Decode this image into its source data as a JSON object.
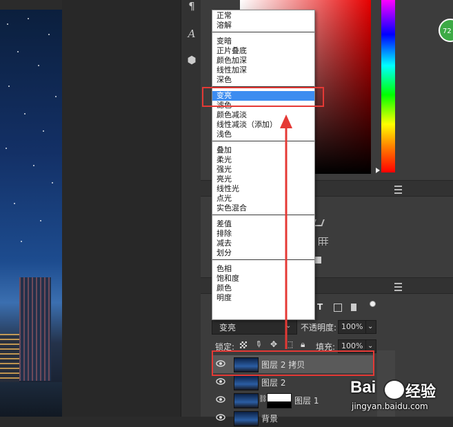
{
  "blend_modes": {
    "groups": [
      [
        "正常",
        "溶解"
      ],
      [
        "变暗",
        "正片叠底",
        "颜色加深",
        "线性加深",
        "深色"
      ],
      [
        "变亮",
        "滤色",
        "颜色减淡",
        "线性减淡（添加）",
        "浅色"
      ],
      [
        "叠加",
        "柔光",
        "强光",
        "亮光",
        "线性光",
        "点光",
        "实色混合"
      ],
      [
        "差值",
        "排除",
        "减去",
        "划分"
      ],
      [
        "色相",
        "饱和度",
        "颜色",
        "明度"
      ]
    ],
    "selected": "变亮"
  },
  "layers_panel": {
    "blend_mode_value": "变亮",
    "opacity_label": "不透明度:",
    "opacity_value": "100%",
    "lock_label": "锁定:",
    "fill_label": "填充:",
    "fill_value": "100%",
    "layers": [
      {
        "name": "图层 2 拷贝",
        "selected": true
      },
      {
        "name": "图层 2",
        "selected": false
      },
      {
        "name": "图层 1",
        "selected": false,
        "has_mask": true
      },
      {
        "name": "背景",
        "selected": false
      }
    ]
  },
  "toolstrip": {
    "icons": [
      "paragraph-icon",
      "character-icon",
      "3d-icon"
    ],
    "glyphs": [
      "¶",
      "A",
      "⬢"
    ]
  },
  "badge": {
    "text": "72"
  },
  "watermark": {
    "brand": "Bai",
    "suffix": "经验",
    "url": "jingyan.baidu.com"
  },
  "colors": {
    "accent": "#e53935",
    "selection": "#3d8cf0"
  }
}
